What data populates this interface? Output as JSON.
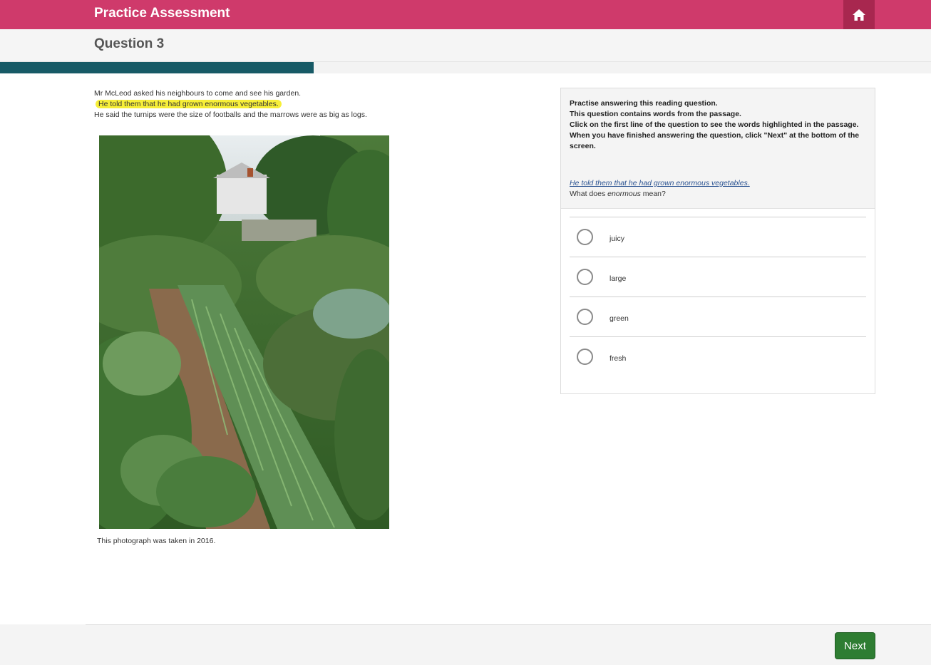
{
  "header": {
    "app_title": "Practice Assessment",
    "home_icon": "home-icon",
    "brand_color": "#cf3a6b"
  },
  "subheader": {
    "question_title": "Question 3"
  },
  "progress": {
    "fraction": 0.337,
    "color": "#175a66"
  },
  "passage": {
    "lines": [
      "Mr McLeod asked his neighbours to come and see his garden.",
      "He told them that he had grown enormous vegetables.",
      "He said the turnips were the size of footballs and the marrows were as big as logs."
    ],
    "highlighted_line_index": 1,
    "photo_caption": "This photograph was taken in 2016."
  },
  "question_panel": {
    "instructions": [
      "Practise answering this reading question.",
      "This question contains words from the passage.",
      "Click on the first line of the question to see the words highlighted in the passage.",
      "When you have finished answering the question, click \"Next\" at the bottom of the screen."
    ],
    "question_link": "He told them that he had grown enormous vegetables.",
    "question_prefix": "What does ",
    "question_word": "enormous",
    "question_suffix": " mean?",
    "options": [
      "juicy",
      "large",
      "green",
      "fresh"
    ]
  },
  "footer": {
    "next_label": "Next"
  }
}
